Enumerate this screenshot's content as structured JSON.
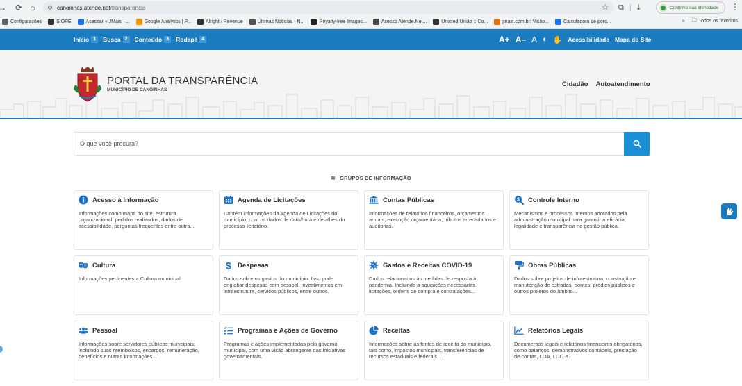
{
  "browser": {
    "url_host": "canoinhas.atende.net",
    "url_path": "/transparencia",
    "identity_label": "Confirme sua identidade",
    "bookmarks": [
      {
        "label": "Configurações",
        "color": "#5f6368"
      },
      {
        "label": "SIOPE",
        "color": "#333333"
      },
      {
        "label": "Acessar « JMais –...",
        "color": "#1a73e8"
      },
      {
        "label": "Google Analytics | P...",
        "color": "#f29900"
      },
      {
        "label": "Alright / Revenue",
        "color": "#333333"
      },
      {
        "label": "Últimas Notícias - N...",
        "color": "#555555"
      },
      {
        "label": "Royalty-free Images...",
        "color": "#222222"
      },
      {
        "label": "Acesso Atende.Net...",
        "color": "#444444"
      },
      {
        "label": "Unicred União :: Co...",
        "color": "#333333"
      },
      {
        "label": "jmais.com.br: Visão...",
        "color": "#e8710a"
      },
      {
        "label": "Calculadora de porc...",
        "color": "#1a73e8"
      }
    ],
    "all_bookmarks_label": "Todos os favoritos"
  },
  "topbar": {
    "skip_links": [
      {
        "label": "Início",
        "num": "1"
      },
      {
        "label": "Busca",
        "num": "2"
      },
      {
        "label": "Conteúdo",
        "num": "3"
      },
      {
        "label": "Rodapé",
        "num": "4"
      }
    ],
    "font_increase": "A+",
    "font_decrease": "A–",
    "font_reset": "A",
    "accessibility_label": "Acessibilidade",
    "sitemap_label": "Mapa do Site"
  },
  "header": {
    "title": "PORTAL DA TRANSPARÊNCIA",
    "subtitle": "MUNICÍPIO DE CANOINHAS",
    "nav": [
      "Cidadão",
      "Autoatendimento"
    ]
  },
  "search": {
    "placeholder": "O que você procura?"
  },
  "groups": {
    "title": "GRUPOS DE INFORMAÇÃO",
    "cards": [
      {
        "title": "Acesso à Informação",
        "icon": "info-icon",
        "desc": "Informações como mapa do site, estrutura organizacional, pedidos realizados, dados de acessibilidade, perguntas frequentes entre outra..."
      },
      {
        "title": "Agenda de Licitações",
        "icon": "calendar-icon",
        "desc": "Contém informações da Agenda de Licitações do município, com os dados de data/hora e detalhes do processo licitatório."
      },
      {
        "title": "Contas Públicas",
        "icon": "bank-icon",
        "desc": "Informações de relatórios financeiros, orçamentos anuais, execução orçamentária, tributos arrecadados e auditorias."
      },
      {
        "title": "Controle Interno",
        "icon": "search-dollar-icon",
        "desc": "Mecanismos e processos internos adotados pela administração municipal para garantir a eficácia, legalidade e transparência na gestão pública."
      },
      {
        "title": "Cultura",
        "icon": "theater-masks-icon",
        "desc": "Informações pertinentes a Cultura municipal."
      },
      {
        "title": "Despesas",
        "icon": "dollar-icon",
        "desc": "Dados sobre os gastos do município. Isso pode englobar despesas com pessoal, investimentos em infraestrutura, serviços públicos, entre outros."
      },
      {
        "title": "Gastos e Receitas COVID-19",
        "icon": "virus-icon",
        "desc": "Dados relacionados às medidas de resposta à pandemia. Incluindo a aquisições necessárias, licitações, ordens de compra e contratações..."
      },
      {
        "title": "Obras Públicas",
        "icon": "paint-roller-icon",
        "desc": "Dados sobre projetos de infraestrutura, construção e manutenção de estradas, pontes, prédios públicos e outros projetos do âmbito..."
      },
      {
        "title": "Pessoal",
        "icon": "users-icon",
        "desc": "Informações sobre servidores públicos municipais, incluindo suas reembolsos, encargos, remuneração, benefícios e outras informações..."
      },
      {
        "title": "Programas e Ações de Governo",
        "icon": "list-check-icon",
        "desc": "Programas e ações implementadas pelo governo municipal, com uma visão abrangente das iniciativas governamentais."
      },
      {
        "title": "Receitas",
        "icon": "pie-chart-icon",
        "desc": "Informações sobre as fontes de receita do município, tais como, impostos municipais, transferências de recursos estaduais e federais,..."
      },
      {
        "title": "Relatórios Legais",
        "icon": "line-chart-icon",
        "desc": "Documentos legais e relatórios financeiros obrigatórios, como balanços, demonstrativos contábeis, prestação de contas, LOA, LDO e..."
      }
    ]
  },
  "colors": {
    "primary": "#1a7bbf",
    "button": "#1a8fd6",
    "icon": "#1a73c9"
  }
}
